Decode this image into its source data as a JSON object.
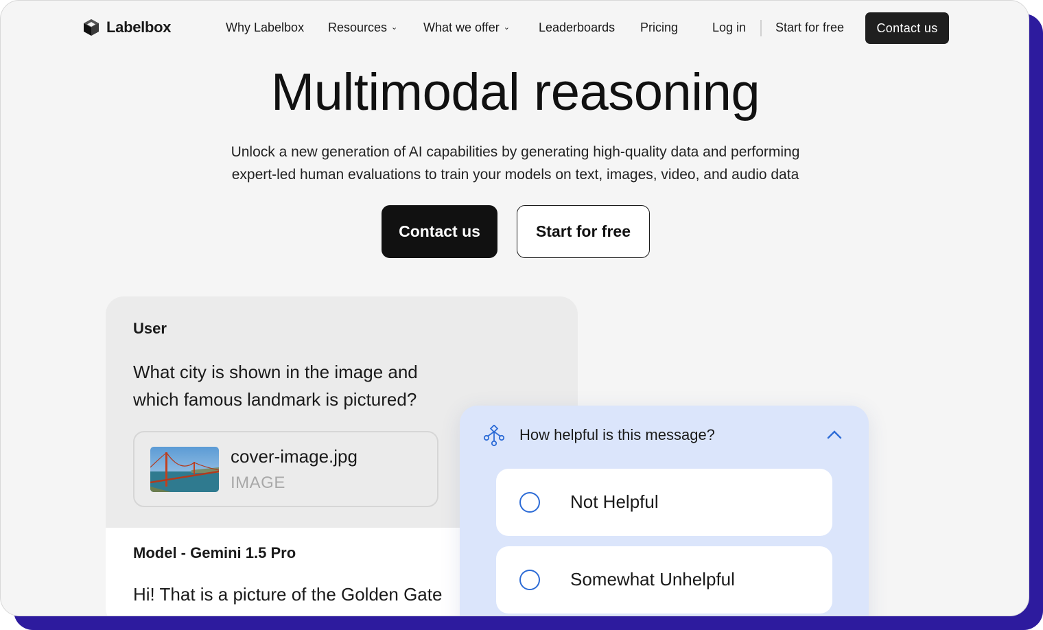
{
  "nav": {
    "brand": "Labelbox",
    "links": [
      {
        "label": "Why Labelbox",
        "dropdown": false
      },
      {
        "label": "Resources",
        "dropdown": true
      },
      {
        "label": "What we offer",
        "dropdown": true
      },
      {
        "label": "Leaderboards",
        "dropdown": false
      },
      {
        "label": "Pricing",
        "dropdown": false
      }
    ],
    "login": "Log in",
    "start_free": "Start for free",
    "contact": "Contact us"
  },
  "hero": {
    "title": "Multimodal reasoning",
    "subtitle_line1": "Unlock a new generation of AI capabilities by generating high-quality data and performing",
    "subtitle_line2": "expert-led human evaluations to train your models on text, images, video, and audio data",
    "primary_button": "Contact us",
    "secondary_button": "Start for free"
  },
  "chat": {
    "user_label": "User",
    "question": "What city is shown in the image and which famous landmark is pictured?",
    "attachment": {
      "file_name": "cover-image.jpg",
      "file_type": "IMAGE"
    },
    "model_label": "Model - Gemini 1.5 Pro",
    "model_reply": "Hi! That is a picture of the Golden Gate"
  },
  "rating": {
    "question": "How helpful is this message?",
    "options": [
      {
        "label": "Not Helpful"
      },
      {
        "label": "Somewhat Unhelpful"
      }
    ]
  },
  "colors": {
    "backdrop": "#2d1b9e",
    "page_bg": "#f5f5f5",
    "dark_button": "#111111",
    "rating_bg": "#dbe5fb",
    "radio_accent": "#2c6bd6"
  }
}
